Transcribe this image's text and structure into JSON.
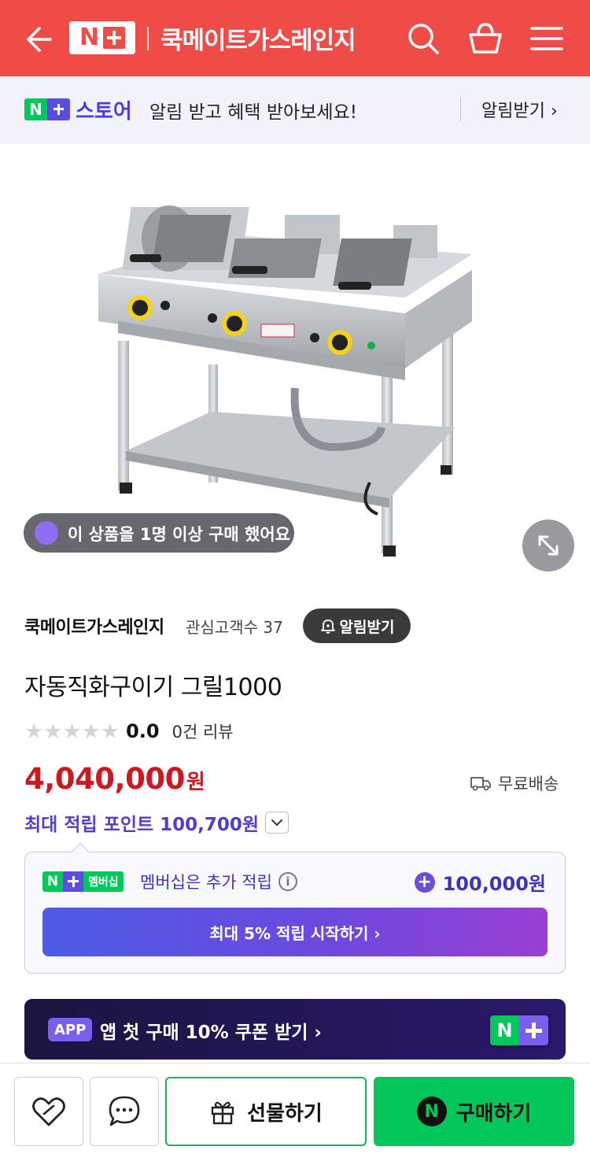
{
  "header": {
    "logo_text": "N+",
    "store_name": "쿡메이트가스레인지"
  },
  "alert_banner": {
    "brand_word": "스토어",
    "message": "알림 받고 혜택 받아보세요!",
    "link_label": "알림받기 ›"
  },
  "product": {
    "purchase_badge": "이 상품을 1명 이상 구매 했어요",
    "seller_name": "쿡메이트가스레인지",
    "followers_label": "관심고객수 37",
    "follow_button": "알림받기",
    "title": "자동직화구이기 그릴1000",
    "rating_score": "0.0",
    "rating_stars": 0,
    "review_count": "0건 리뷰",
    "price_number": "4,040,000",
    "price_unit": "원",
    "shipping": "무료배송",
    "max_points": "최대 적립 포인트 100,700원"
  },
  "membership": {
    "badge_label": "멤버십",
    "text": "멤버십은 추가 적립",
    "info_glyph": "i",
    "bonus": "100,000원",
    "start_button": "최대 5% 적립 시작하기 ›"
  },
  "app_banner": {
    "tag": "APP",
    "text": "앱 첫 구매 10% 쿠폰 받기 ›"
  },
  "bottom_bar": {
    "gift_label": "선물하기",
    "buy_label": "구매하기"
  },
  "colors": {
    "header_red": "#ef4b47",
    "naver_green": "#03c75a",
    "price_red": "#d0171f",
    "points_purple": "#5040c8"
  },
  "icons": {
    "back": "arrow-left-icon",
    "search": "search-icon",
    "cart": "shopping-basket-icon",
    "menu": "hamburger-menu-icon",
    "expand": "expand-arrows-icon",
    "bell": "bell-icon",
    "truck": "truck-icon",
    "wishlist": "heart-icon",
    "chat": "chat-bubble-icon",
    "gift": "gift-icon"
  }
}
